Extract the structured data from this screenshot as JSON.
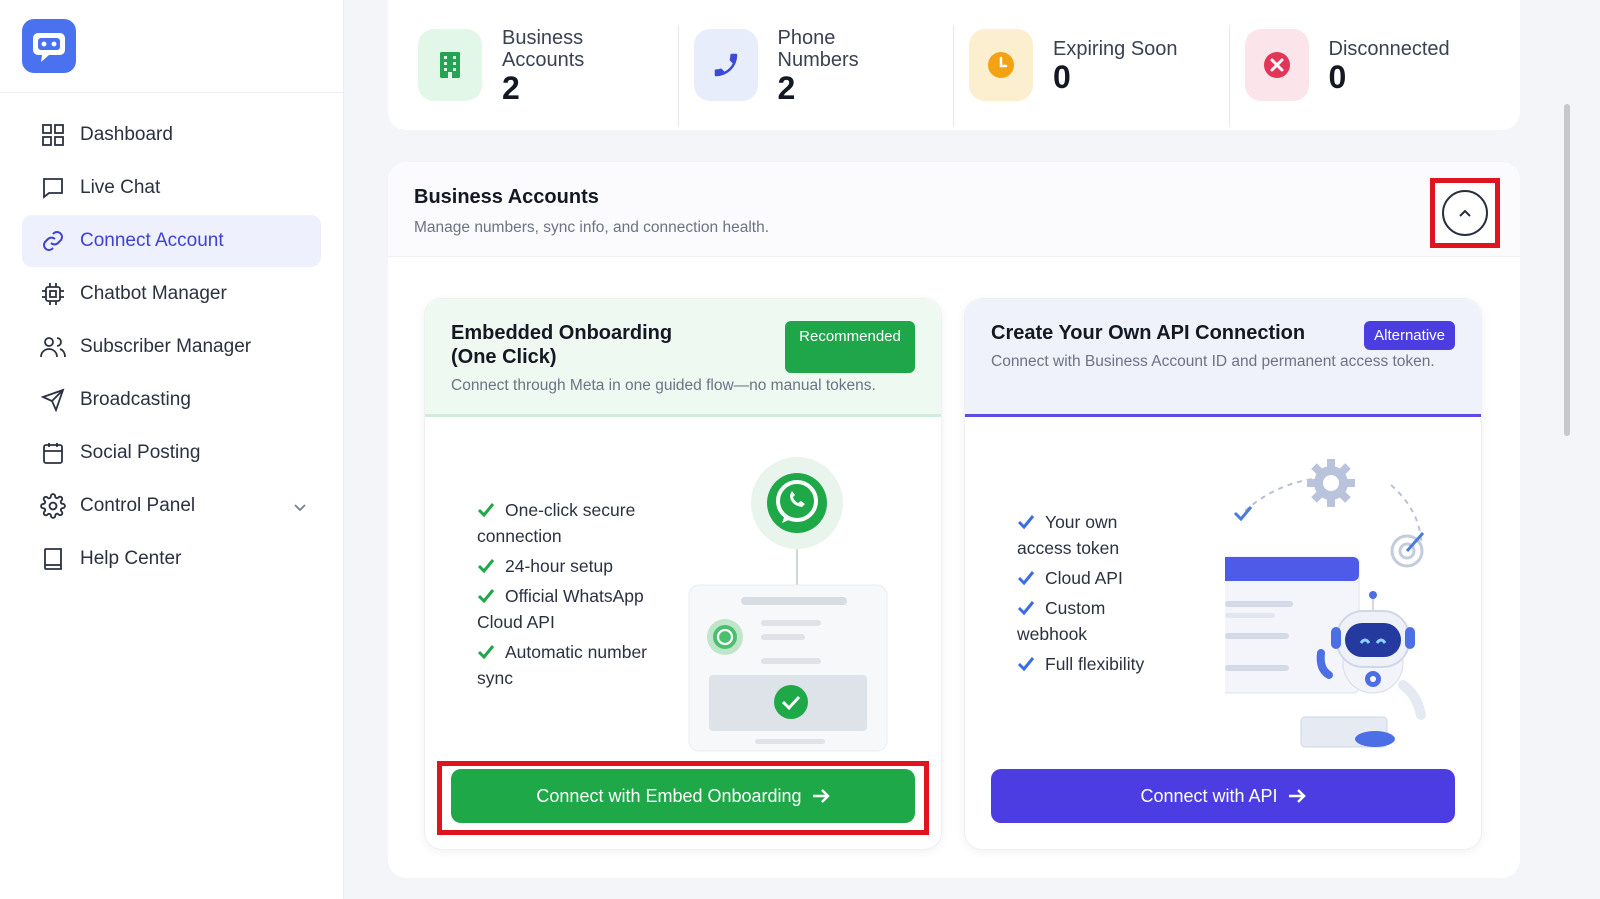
{
  "sidebar": {
    "items": [
      {
        "label": "Dashboard"
      },
      {
        "label": "Live Chat"
      },
      {
        "label": "Connect Account"
      },
      {
        "label": "Chatbot Manager"
      },
      {
        "label": "Subscriber Manager"
      },
      {
        "label": "Broadcasting"
      },
      {
        "label": "Social Posting"
      },
      {
        "label": "Control Panel"
      },
      {
        "label": "Help Center"
      }
    ],
    "active": "Connect Account"
  },
  "stats": [
    {
      "label1": "Business",
      "label2": "Accounts",
      "value": "2",
      "icon": "building-icon",
      "bg": "#e3f7e9",
      "color": "#23a455"
    },
    {
      "label1": "Phone",
      "label2": "Numbers",
      "value": "2",
      "icon": "phone-icon",
      "bg": "#e8edfb",
      "color": "#3b4bd8"
    },
    {
      "label1": "Expiring Soon",
      "label2": "",
      "value": "0",
      "icon": "clock-icon",
      "bg": "#fcefcf",
      "color": "#f2a213"
    },
    {
      "label1": "Disconnected",
      "label2": "",
      "value": "0",
      "icon": "x-circle-icon",
      "bg": "#fbe4ea",
      "color": "#e23558"
    }
  ],
  "panel": {
    "title": "Business Accounts",
    "subtitle": "Manage numbers, sync info, and connection health."
  },
  "embedded": {
    "title": "Embedded Onboarding (One Click)",
    "badge": "Recommended",
    "subtitle": "Connect through Meta in one guided flow—no manual tokens.",
    "features": [
      "One-click secure connection",
      "24-hour setup",
      "Official WhatsApp Cloud API",
      "Automatic number sync"
    ],
    "button": "Connect with Embed Onboarding"
  },
  "api": {
    "title": "Create Your Own API Connection",
    "badge": "Alternative",
    "subtitle": "Connect with Business Account ID and permanent access token.",
    "features": [
      "Your own access token",
      "Cloud API",
      "Custom webhook",
      "Full flexibility"
    ],
    "button": "Connect with API"
  },
  "colors": {
    "accent": "#3f42d0",
    "green": "#1ea848",
    "purple": "#4b3de2",
    "highlight": "#e0141e"
  }
}
